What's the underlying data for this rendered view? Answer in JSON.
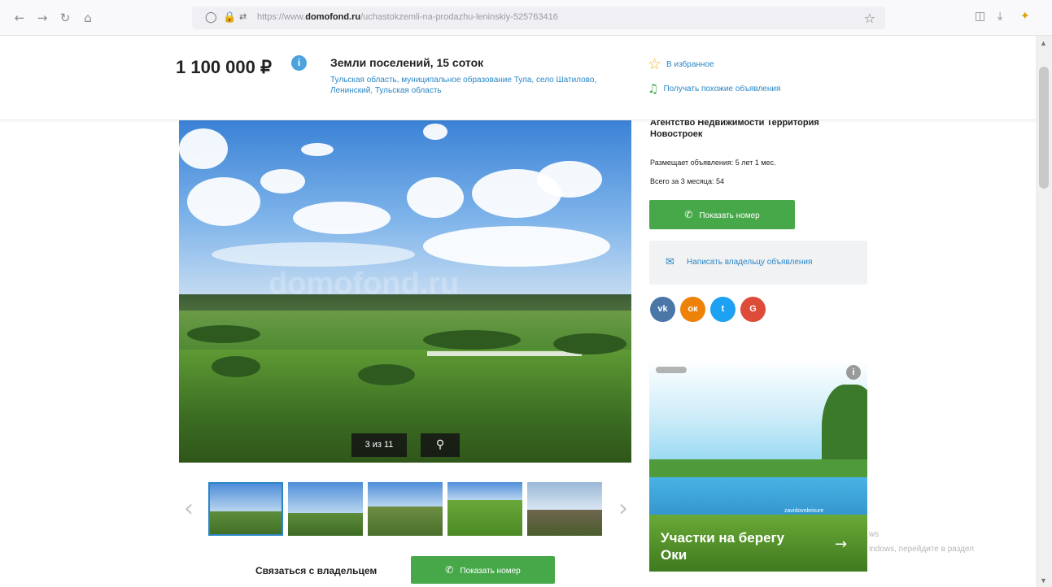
{
  "browser": {
    "url_prefix": "https://www.",
    "url_domain": "domofond.ru",
    "url_path": "/uchastokzemli-na-prodazhu-leninskiy-525763416"
  },
  "listing": {
    "price": "1 100 000 ₽",
    "info_badge": "i",
    "title": "Земли поселений, 15 соток",
    "address": "Тульская область, муниципальное образование Тула, село Шатилово, Ленинский, Тульская область"
  },
  "actions": {
    "favorite": "В избранное",
    "similar": "Получать похожие объявления"
  },
  "seller": {
    "agency": "Агентство Недвижимости Территория Новостроек",
    "posting_since": "Размещает объявления: 5 лет 1 мес.",
    "total_3_months": "Всего за 3 месяца: 54",
    "show_phone": "Показать номер",
    "write_owner": "Написать владельцу объявления"
  },
  "gallery": {
    "counter": "3 из 11",
    "watermark": "domofond.ru"
  },
  "contact": {
    "label": "Связаться с владельцем",
    "show_phone": "Показать номер"
  },
  "social": [
    {
      "name": "vk",
      "label": "vk",
      "color": "#4a76a8"
    },
    {
      "name": "ok",
      "label": "ок",
      "color": "#ee8208"
    },
    {
      "name": "twitter",
      "label": "t",
      "color": "#1da1f2"
    },
    {
      "name": "google",
      "label": "G",
      "color": "#dd4b39"
    }
  ],
  "ad": {
    "small_text": "zavidovoleisure",
    "caption": "Участки на берегу Оки"
  },
  "windows_overlay": {
    "line1": "ws",
    "line2": "indows, перейдите в раздел"
  },
  "colors": {
    "accent_blue": "#2b86c5",
    "button_green": "#47a84a"
  }
}
